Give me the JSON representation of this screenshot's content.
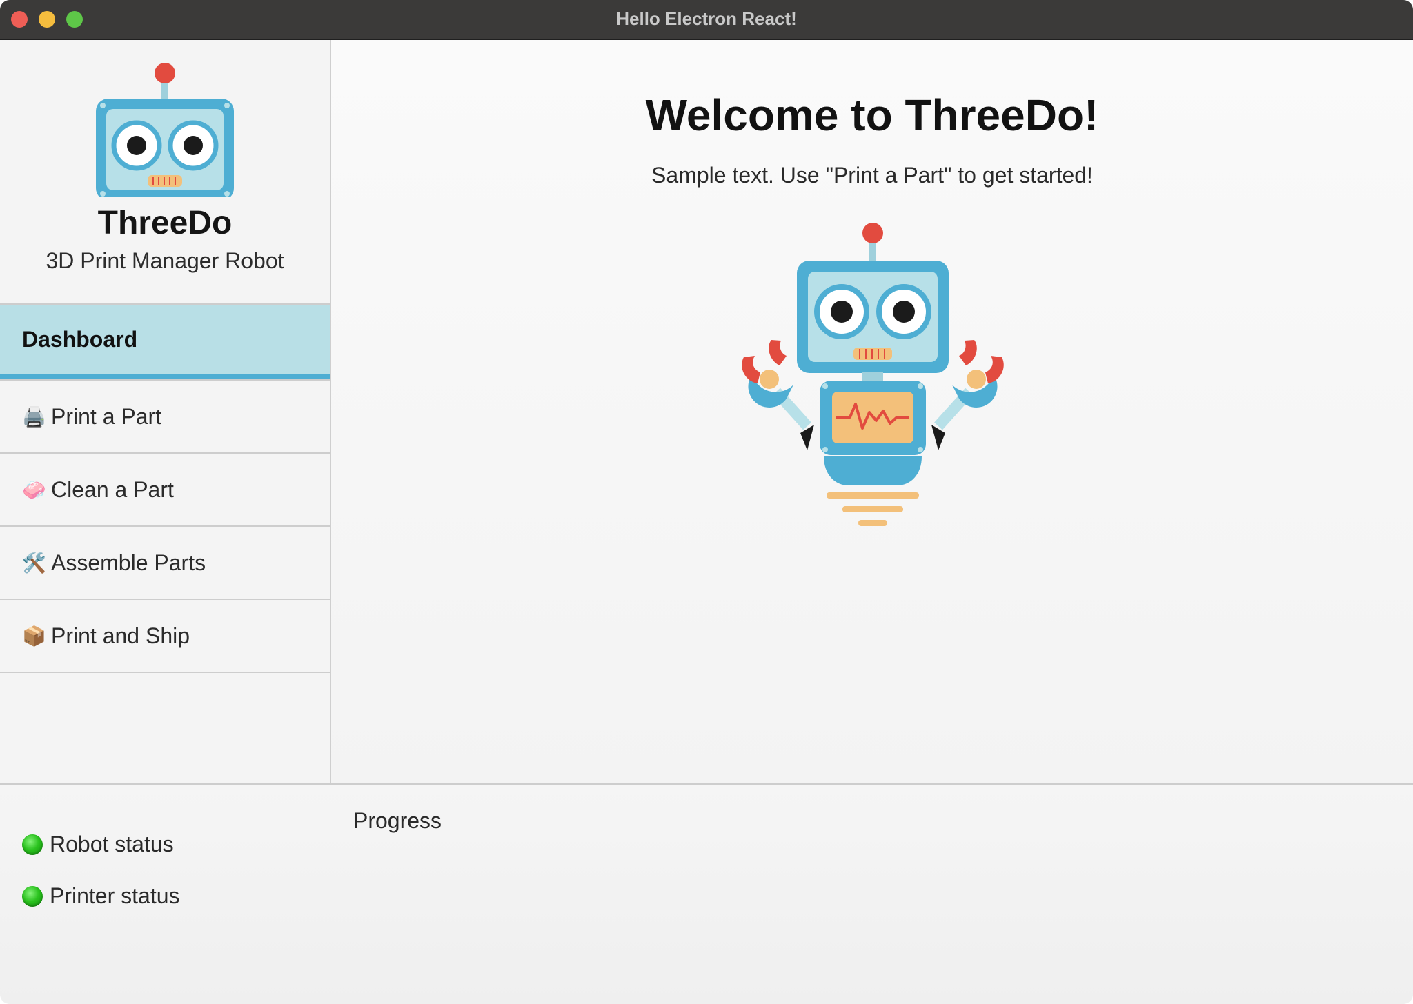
{
  "window": {
    "title": "Hello Electron React!"
  },
  "sidebar": {
    "app_name": "ThreeDo",
    "tagline": "3D Print Manager Robot",
    "items": [
      {
        "label": "Dashboard",
        "emoji": "",
        "active": true
      },
      {
        "label": "Print a Part",
        "emoji": "🖨️",
        "active": false
      },
      {
        "label": "Clean a Part",
        "emoji": "🧼",
        "active": false
      },
      {
        "label": "Assemble Parts",
        "emoji": "🛠️",
        "active": false
      },
      {
        "label": "Print and Ship",
        "emoji": "📦",
        "active": false
      }
    ]
  },
  "main": {
    "heading": "Welcome to ThreeDo!",
    "subtitle": "Sample text. Use \"Print a Part\" to get started!"
  },
  "footer": {
    "statuses": [
      {
        "label": "Robot status",
        "state": "ok",
        "color": "#2bc31f"
      },
      {
        "label": "Printer status",
        "state": "ok",
        "color": "#2bc31f"
      }
    ],
    "progress_label": "Progress"
  },
  "colors": {
    "active_nav_bg": "#b8dfe6",
    "active_nav_accent": "#4eaed3",
    "robot_blue": "#4eaed3",
    "robot_screen": "#b7e0e8",
    "robot_red": "#e24b3f",
    "robot_orange": "#f3c07a"
  },
  "icons": {
    "logo": "robot-head-icon",
    "hero": "robot-full-icon",
    "status": "green-dot-icon"
  }
}
